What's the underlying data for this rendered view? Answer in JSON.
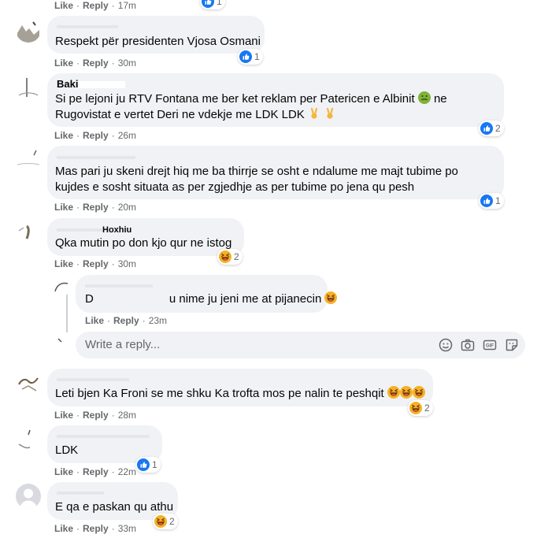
{
  "comments": [
    {
      "name": "",
      "text": "",
      "like": "Like",
      "reply": "Reply",
      "time": "17m",
      "reaction_count": "1"
    },
    {
      "name": "",
      "text": "Respekt për presidenten Vjosa Osmani",
      "like": "Like",
      "reply": "Reply",
      "time": "30m",
      "reaction_count": "1"
    },
    {
      "name": "Baki",
      "line1": "Si pe lejoni ju RTV Fontana me ber ket reklam per Patericen e Albinit",
      "line1b": "ne",
      "line2": "Rugovistat e vertet Deri ne vdekje me LDK LDK",
      "like": "Like",
      "reply": "Reply",
      "time": "26m",
      "reaction_count": "2"
    },
    {
      "name": "",
      "line1": "Mas pari ju skeni drejt hiq me ba thirrje se osht e ndalume me majt tubime po",
      "line2": "kujdes e sosht situata as per zgjedhje as per tubime po jena qu pesh",
      "like": "Like",
      "reply": "Reply",
      "time": "20m",
      "reaction_count": "1"
    },
    {
      "name": "Hoxhiu",
      "text": "Qka mutin po don kjo qur ne istog",
      "like": "Like",
      "reply": "Reply",
      "time": "30m",
      "reaction_count": "2"
    },
    {
      "name": "",
      "text_prefix": "D",
      "text": "u nime ju jeni me at pijanecin",
      "like": "Like",
      "reply": "Reply",
      "time": "23m"
    },
    {
      "name": "",
      "text": "Leti bjen Ka Froni se me shku Ka trofta mos pe nalin te peshqit",
      "like": "Like",
      "reply": "Reply",
      "time": "28m",
      "reaction_count": "2"
    },
    {
      "name": "",
      "text": "LDK",
      "like": "Like",
      "reply": "Reply",
      "time": "22m",
      "reaction_count": "1"
    },
    {
      "name": "",
      "text": "E qa e paskan qu athu",
      "like": "Like",
      "reply": "Reply",
      "time": "33m",
      "reaction_count": "2"
    }
  ],
  "reply_box": {
    "placeholder": "Write a reply..."
  },
  "icons": {
    "like_reaction": "like-reaction-icon",
    "haha_reaction": "haha-reaction-icon",
    "sick_emoji": "nauseated-face-icon",
    "victory_emoji": "victory-hand-icon",
    "smile": "smile-icon",
    "camera": "camera-icon",
    "gif": "gif-icon",
    "sticker": "sticker-icon"
  },
  "colors": {
    "bubble": "#f0f2f5",
    "like_blue": "#1877f2",
    "haha_yellow": "#f7b125",
    "meta_gray": "#65676b"
  }
}
